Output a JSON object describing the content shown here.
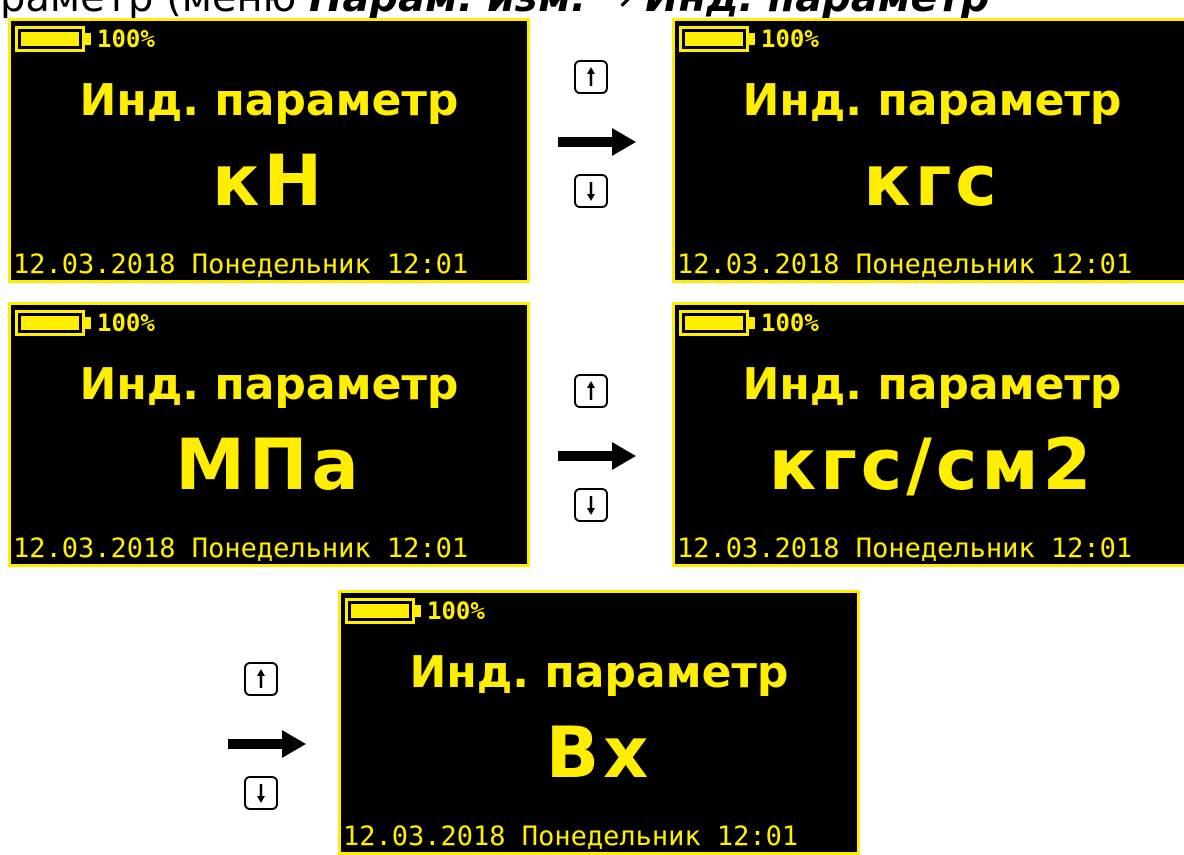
{
  "header": {
    "prefix": "раметр (меню ",
    "menu_item": "Парам. изм.",
    "separator": " → ",
    "target": "Инд. параметр"
  },
  "colors": {
    "screen_bg": "#000000",
    "screen_fg": "#ffee00"
  },
  "screens": [
    {
      "battery_pct": "100%",
      "title": "Инд. параметр",
      "value": "кН",
      "status": "12.03.2018 Понедельник 12:01"
    },
    {
      "battery_pct": "100%",
      "title": "Инд. параметр",
      "value": "кгс",
      "status": "12.03.2018 Понедельник 12:01"
    },
    {
      "battery_pct": "100%",
      "title": "Инд. параметр",
      "value": "МПа",
      "status": "12.03.2018 Понедельник 12:01"
    },
    {
      "battery_pct": "100%",
      "title": "Инд. параметр",
      "value": "кгс/см2",
      "status": "12.03.2018 Понедельник 12:01"
    },
    {
      "battery_pct": "100%",
      "title": "Инд. параметр",
      "value": "Вх",
      "status": "12.03.2018 Понедельник 12:01"
    }
  ],
  "icons": {
    "up_key": "arrow-up-key-icon",
    "down_key": "arrow-down-key-icon",
    "transition": "right-arrow-icon",
    "battery": "battery-icon"
  },
  "battery_level": 1.0
}
